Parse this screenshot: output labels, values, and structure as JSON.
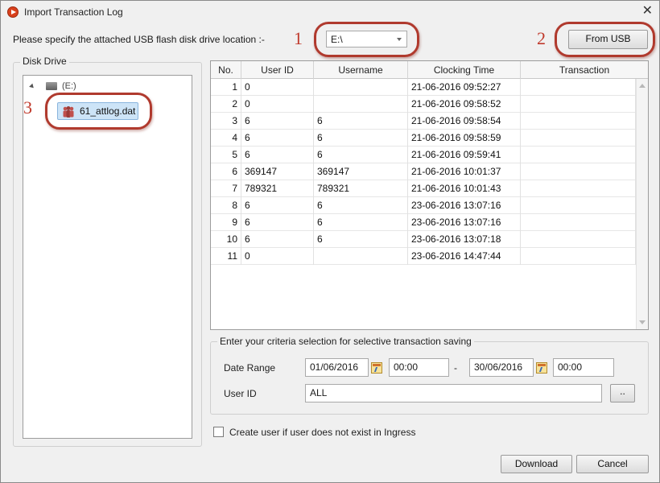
{
  "window": {
    "title": "Import Transaction Log",
    "close_glyph": "✕"
  },
  "location": {
    "label": "Please specify the attached USB flash disk drive location :-",
    "drive_value": "E:\\",
    "from_usb_label": "From USB"
  },
  "callouts": [
    "1",
    "2",
    "3"
  ],
  "disk_drive": {
    "group_title": "Disk Drive",
    "drive_label": "(E:)",
    "file_name": "61_attlog.dat"
  },
  "grid": {
    "columns": [
      "No.",
      "User ID",
      "Username",
      "Clocking Time",
      "Transaction"
    ],
    "rows": [
      {
        "no": "1",
        "user_id": "0",
        "username": "",
        "time": "21-06-2016 09:52:27",
        "transaction": ""
      },
      {
        "no": "2",
        "user_id": "0",
        "username": "",
        "time": "21-06-2016 09:58:52",
        "transaction": ""
      },
      {
        "no": "3",
        "user_id": "6",
        "username": "6",
        "time": "21-06-2016 09:58:54",
        "transaction": ""
      },
      {
        "no": "4",
        "user_id": "6",
        "username": "6",
        "time": "21-06-2016 09:58:59",
        "transaction": ""
      },
      {
        "no": "5",
        "user_id": "6",
        "username": "6",
        "time": "21-06-2016 09:59:41",
        "transaction": ""
      },
      {
        "no": "6",
        "user_id": "369147",
        "username": "369147",
        "time": "21-06-2016 10:01:37",
        "transaction": ""
      },
      {
        "no": "7",
        "user_id": "789321",
        "username": "789321",
        "time": "21-06-2016 10:01:43",
        "transaction": ""
      },
      {
        "no": "8",
        "user_id": "6",
        "username": "6",
        "time": "23-06-2016 13:07:16",
        "transaction": ""
      },
      {
        "no": "9",
        "user_id": "6",
        "username": "6",
        "time": "23-06-2016 13:07:16",
        "transaction": ""
      },
      {
        "no": "10",
        "user_id": "6",
        "username": "6",
        "time": "23-06-2016 13:07:18",
        "transaction": ""
      },
      {
        "no": "11",
        "user_id": "0",
        "username": "",
        "time": "23-06-2016 14:47:44",
        "transaction": ""
      }
    ]
  },
  "criteria": {
    "group_title": "Enter your criteria selection for selective transaction saving",
    "date_range_label": "Date Range",
    "start_date": "01/06/2016",
    "start_time": "00:00",
    "range_separator": "-",
    "end_date": "30/06/2016",
    "end_time": "00:00",
    "user_id_label": "User ID",
    "user_id_value": "ALL",
    "browse_label": ".."
  },
  "options": {
    "create_user_label": "Create user if user does not exist in Ingress"
  },
  "buttons": {
    "download": "Download",
    "cancel": "Cancel"
  },
  "colors": {
    "callout": "#b03a2e",
    "selection": "#cde4f7"
  }
}
